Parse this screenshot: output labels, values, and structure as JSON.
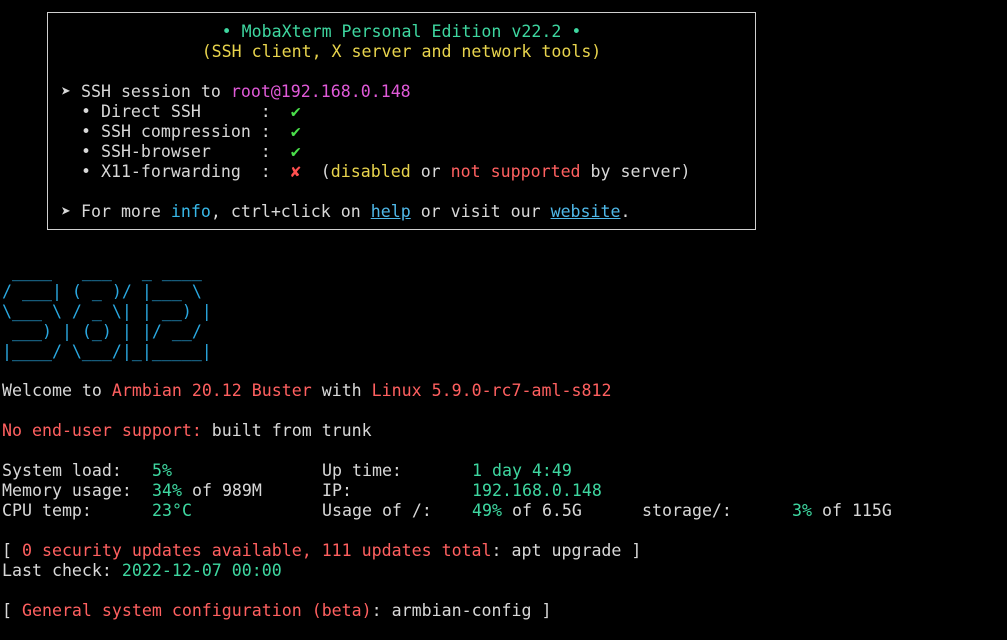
{
  "banner": {
    "title": "• MobaXterm Personal Edition v22.2 •",
    "subtitle": "(SSH client, X server and network tools)",
    "session_prefix": "➤ SSH session to ",
    "session_host": "root@192.168.0.148",
    "features": [
      {
        "label": "  • Direct SSH      :  ",
        "mark": "✔"
      },
      {
        "label": "  • SSH compression :  ",
        "mark": "✔"
      },
      {
        "label": "  • SSH-browser     :  ",
        "mark": "✔"
      },
      {
        "label": "  • X11-forwarding  :  ",
        "mark": "✘"
      }
    ],
    "x11_note": {
      "open": "  (",
      "disabled": "disabled",
      "or": " or ",
      "not_supported": "not supported",
      "tail": " by server)"
    },
    "more": {
      "prefix": "➤ For more ",
      "info": "info",
      "mid": ", ctrl+click on ",
      "help": "help",
      "or_visit": " or visit our ",
      "website": "website",
      "end": "."
    }
  },
  "logo_lines": [
    " ____   ___   _ ____  ",
    "/ ___| ( _ )/ |___ \\ ",
    "\\___ \\ / _ \\| | __) |",
    " ___) | (_) | |/ __/ ",
    "|____/ \\___/|_|_____|"
  ],
  "welcome": {
    "prefix": "Welcome to ",
    "distro": "Armbian 20.12 Buster",
    "with": " with ",
    "kernel": "Linux 5.9.0-rc7-aml-s812"
  },
  "support": {
    "label": "No end-user support:",
    "value": " built from trunk"
  },
  "stats": {
    "system_load_label": "System load:",
    "system_load_value": "5%",
    "up_time_label": "Up time:",
    "up_time_value": "1 day 4:49",
    "memory_label": "Memory usage:",
    "memory_value": "34%",
    "memory_of": " of 989M",
    "ip_label": "IP:",
    "ip_value": "192.168.0.148",
    "cpu_label": "CPU temp:",
    "cpu_value": "23°C",
    "usage_label": "Usage of /:",
    "usage_value": "49%",
    "usage_of": " of 6.5G",
    "storage_label": "storage/:",
    "storage_value": "3%",
    "storage_of": " of 115G"
  },
  "updates": {
    "open": "[ ",
    "text": "0 security updates available, 111 updates total",
    "colon": ": ",
    "cmd": "apt upgrade",
    "close": " ]"
  },
  "last_check": {
    "label": "Last check: ",
    "value": "2022-12-07 00:00"
  },
  "config": {
    "open": "[ ",
    "text": "General system configuration (beta)",
    "colon": ": ",
    "cmd": "armbian-config",
    "close": " ]"
  },
  "colors": {
    "background": "#000000",
    "text": "#d8d8d8",
    "accent_green": "#3ed7a0",
    "accent_red": "#ff6060",
    "accent_magenta": "#e05ad8",
    "accent_yellow": "#e8d44d",
    "logo_blue": "#2aa8e0"
  }
}
